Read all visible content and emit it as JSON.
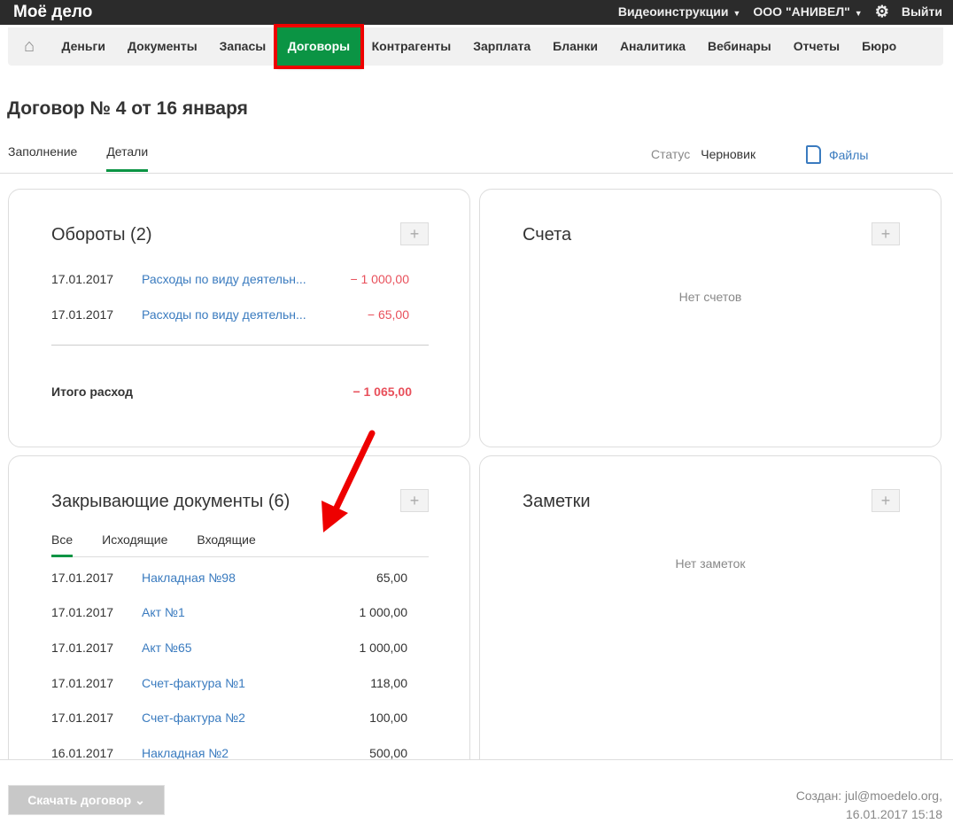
{
  "header": {
    "logo": "Moё дело",
    "video": "Видеоинструкции",
    "org": "ООО \"АНИВЕЛ\"",
    "logout": "Выйти"
  },
  "nav": [
    "Деньги",
    "Документы",
    "Запасы",
    "Договоры",
    "Контрагенты",
    "Зарплата",
    "Бланки",
    "Аналитика",
    "Вебинары",
    "Отчеты",
    "Бюро"
  ],
  "page": {
    "title": "Договор № 4 от 16 января",
    "tabs": [
      "Заполнение",
      "Детали"
    ],
    "status_label": "Статус",
    "status_value": "Черновик",
    "files": "Файлы"
  },
  "turnover": {
    "title": "Обороты (2)",
    "plus": "+",
    "rows": [
      {
        "date": "17.01.2017",
        "name": "Расходы по виду деятельн...",
        "amount": "− 1 000,00"
      },
      {
        "date": "17.01.2017",
        "name": "Расходы по виду деятельн...",
        "amount": "− 65,00"
      }
    ],
    "total_label": "Итого расход",
    "total": "− 1 065,00"
  },
  "invoices": {
    "title": "Счета",
    "plus": "+",
    "empty": "Нет счетов"
  },
  "closing": {
    "title": "Закрывающие документы (6)",
    "plus": "+",
    "tabs": [
      "Все",
      "Исходящие",
      "Входящие"
    ],
    "rows": [
      {
        "date": "17.01.2017",
        "name": "Накладная №98",
        "amount": "65,00"
      },
      {
        "date": "17.01.2017",
        "name": "Акт №1",
        "amount": "1 000,00"
      },
      {
        "date": "17.01.2017",
        "name": "Акт №65",
        "amount": "1 000,00"
      },
      {
        "date": "17.01.2017",
        "name": "Счет-фактура №1",
        "amount": "118,00"
      },
      {
        "date": "17.01.2017",
        "name": "Счет-фактура №2",
        "amount": "100,00"
      },
      {
        "date": "16.01.2017",
        "name": "Накладная №2",
        "amount": "500,00"
      }
    ]
  },
  "notes": {
    "title": "Заметки",
    "plus": "+",
    "empty": "Нет заметок"
  },
  "footer": {
    "download": "Скачать договор",
    "created_line1": "Создан: jul@moedelo.org,",
    "created_line2": "16.01.2017 15:18"
  }
}
